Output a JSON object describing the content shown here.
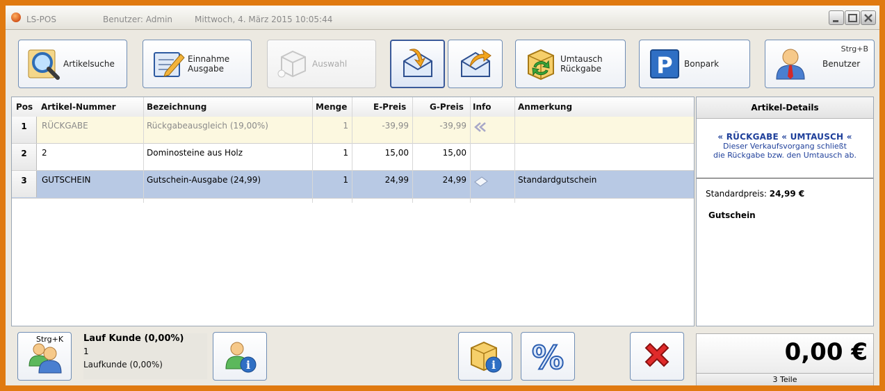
{
  "window": {
    "app_name": "LS-POS",
    "user": "Benutzer: Admin",
    "datetime": "Mittwoch, 4. März 2015   10:05:44"
  },
  "toolbar": {
    "artikelsuche": "Artikelsuche",
    "einnahme": "Einnahme\nAusgabe",
    "auswahl": "Auswahl",
    "umtausch": "Umtausch\nRückgabe",
    "bonpark": "Bonpark",
    "benutzer": "Benutzer",
    "benutzer_hotkey": "Strg+B"
  },
  "grid": {
    "headers": [
      "Pos",
      "Artikel-Nummer",
      "Bezeichnung",
      "Menge",
      "E-Preis",
      "G-Preis",
      "Info",
      "Anmerkung"
    ],
    "rows": [
      {
        "pos": "1",
        "nummer": "RÜCKGABE",
        "bezeichnung": "Rückgabeausgleich (19,00%)",
        "menge": "1",
        "epreis": "-39,99",
        "gpreis": "-39,99",
        "info_icon": "return-arrows-icon",
        "anmerkung": ""
      },
      {
        "pos": "2",
        "nummer": "2",
        "bezeichnung": "Dominosteine aus Holz",
        "menge": "1",
        "epreis": "15,00",
        "gpreis": "15,00",
        "info_icon": "",
        "anmerkung": ""
      },
      {
        "pos": "3",
        "nummer": "GUTSCHEIN",
        "bezeichnung": "Gutschein-Ausgabe (24,99)",
        "menge": "1",
        "epreis": "24,99",
        "gpreis": "24,99",
        "info_icon": "voucher-icon",
        "anmerkung": "Standardgutschein"
      }
    ]
  },
  "details": {
    "title": "Artikel-Details",
    "rueckgabe": "RÜCKGABE",
    "umtausch": "UMTAUSCH",
    "note_line1": "Dieser Verkaufsvorgang schließt",
    "note_line2": "die Rückgabe bzw. den Umtausch ab.",
    "std_label": "Standardpreis: ",
    "std_value": "24,99 €",
    "kind": "Gutschein"
  },
  "bottom": {
    "customer_hotkey": "Strg+K",
    "customer_name": "Lauf Kunde (0,00%)",
    "customer_id": "1",
    "customer_type": "Laufkunde (0,00%)",
    "total": "0,00 €",
    "items": "3 Teile"
  },
  "colors": {
    "frame": "#e07a10",
    "selected_row": "#b8c9e4",
    "return_row": "#fcf8e0",
    "notice_blue": "#1e3f9a"
  }
}
